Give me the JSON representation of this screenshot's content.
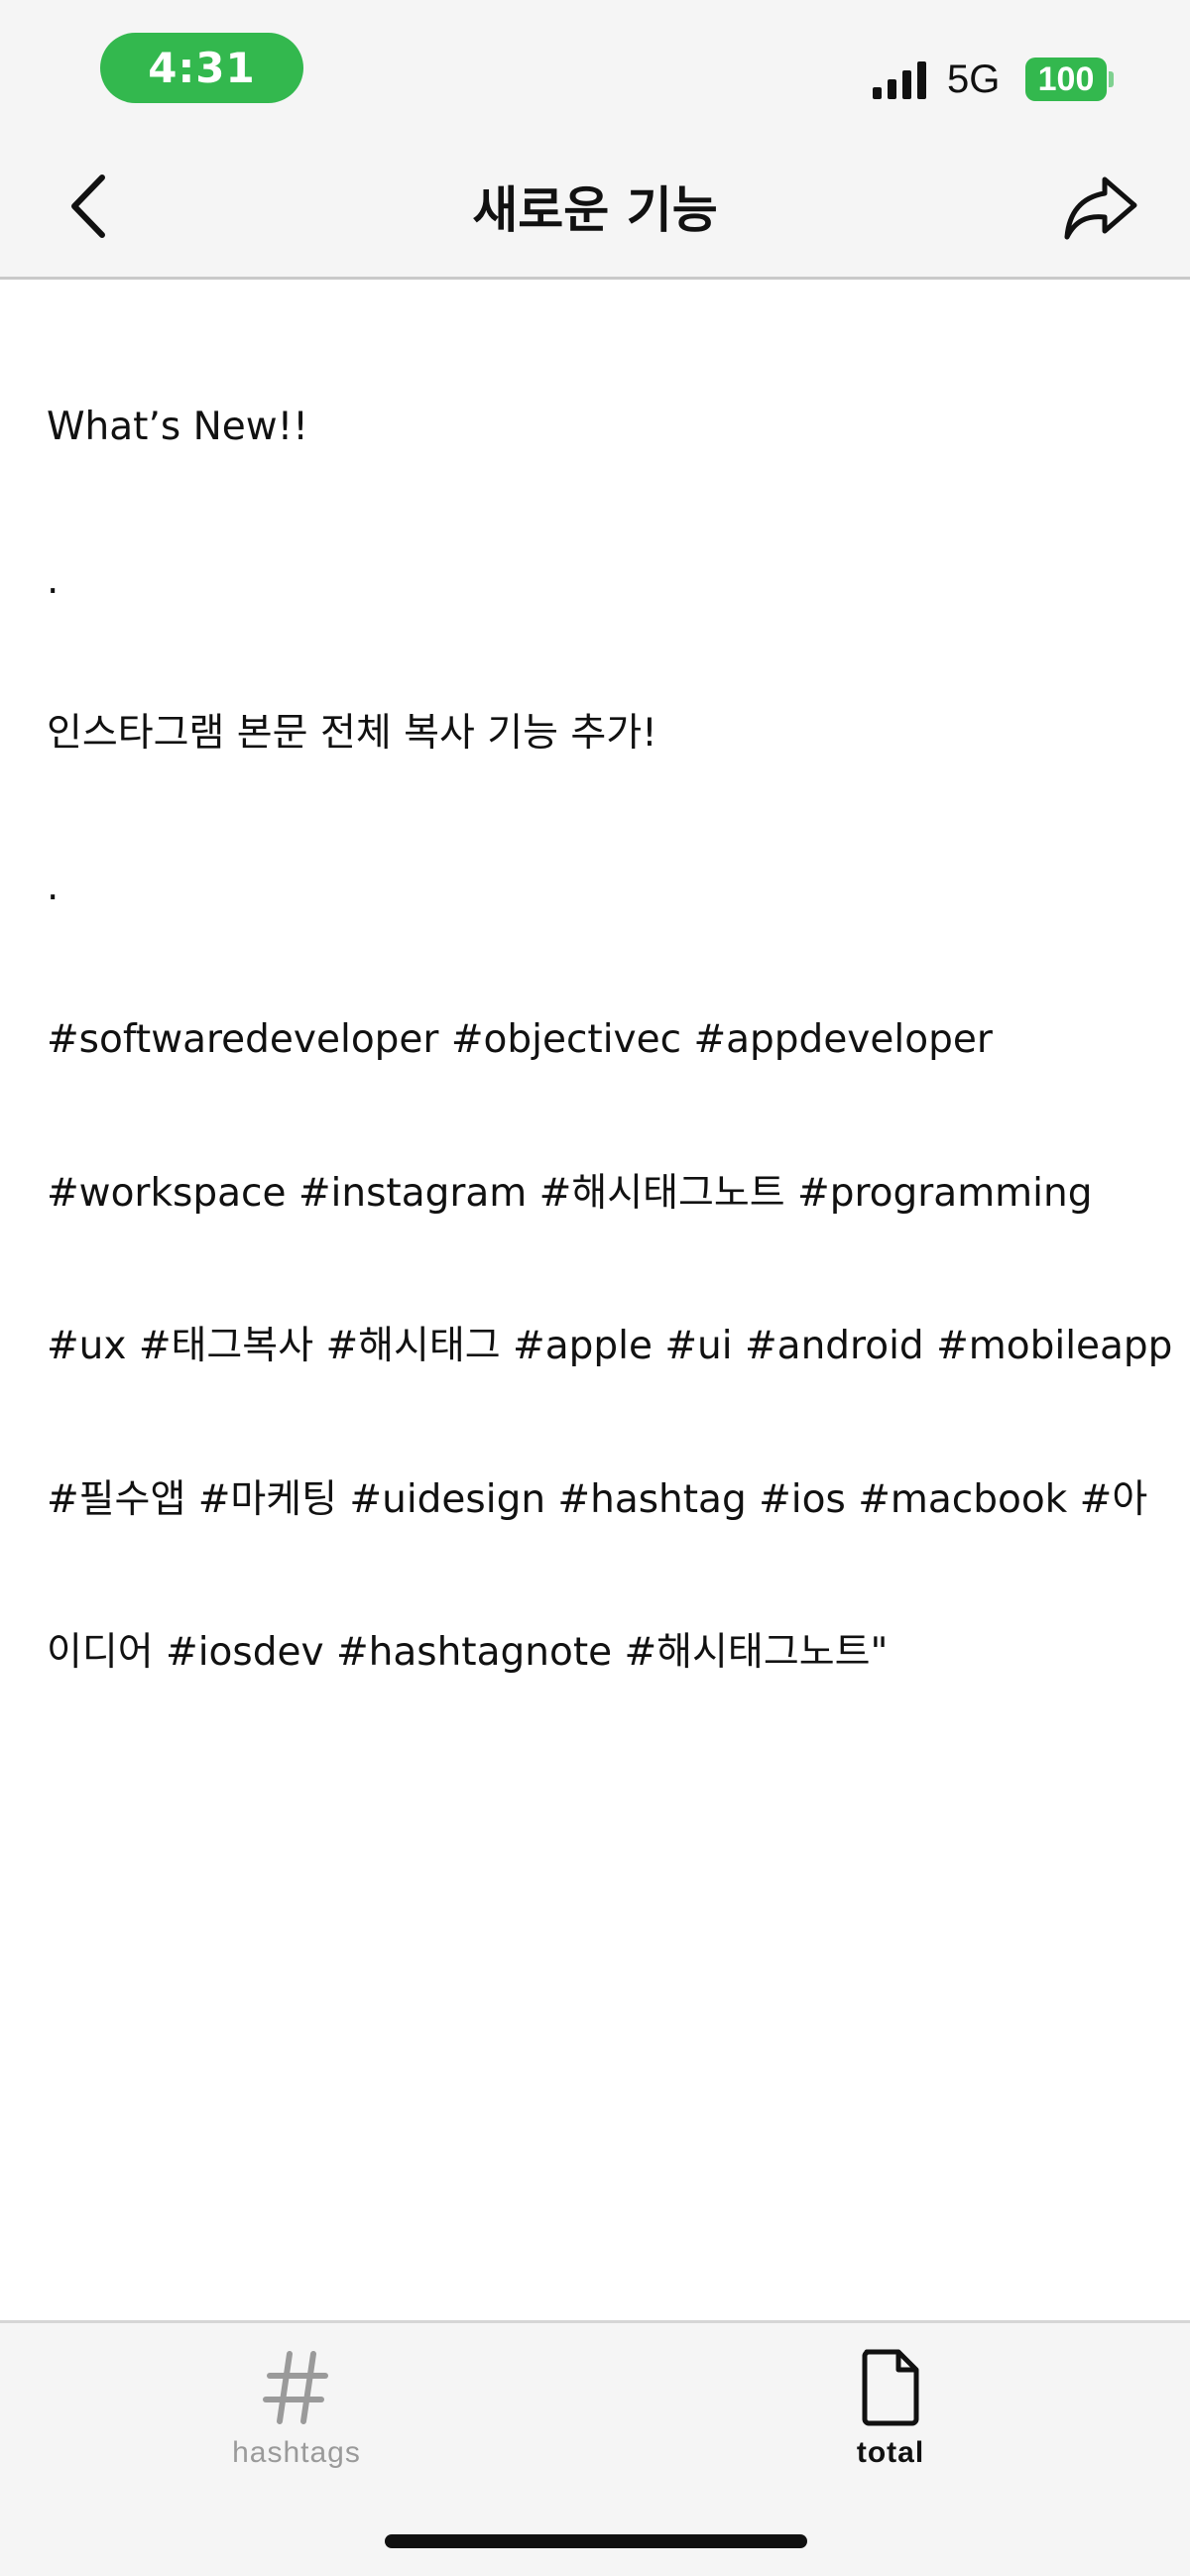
{
  "status_bar": {
    "time": "4:31",
    "network": "5G",
    "battery": "100",
    "icons": [
      "signal-bars-icon",
      "battery-icon"
    ],
    "colors": {
      "time_pill": "#33b84e",
      "battery": "#33b84e"
    }
  },
  "nav": {
    "title": "새로운 기능",
    "back_icon": "chevron-left-icon",
    "share_icon": "share-arrow-icon"
  },
  "content": {
    "lines": [
      "What’s New!!",
      ".",
      "인스타그램 본문 전체 복사 기능 추가!",
      ".",
      "#softwaredeveloper #objectivec #appdeveloper",
      "#workspace #instagram #해시태그노트 #programming",
      "#ux #태그복사 #해시태그 #apple #ui #android #mobileapp",
      "#필수앱 #마케팅 #uidesign #hashtag #ios #macbook #아",
      "이디어 #iosdev #hashtagnote #해시태그노트\""
    ]
  },
  "tab_bar": {
    "tabs": [
      {
        "label": "hashtags",
        "icon": "hashtag-icon",
        "active": false
      },
      {
        "label": "total",
        "icon": "document-icon",
        "active": true
      }
    ]
  }
}
